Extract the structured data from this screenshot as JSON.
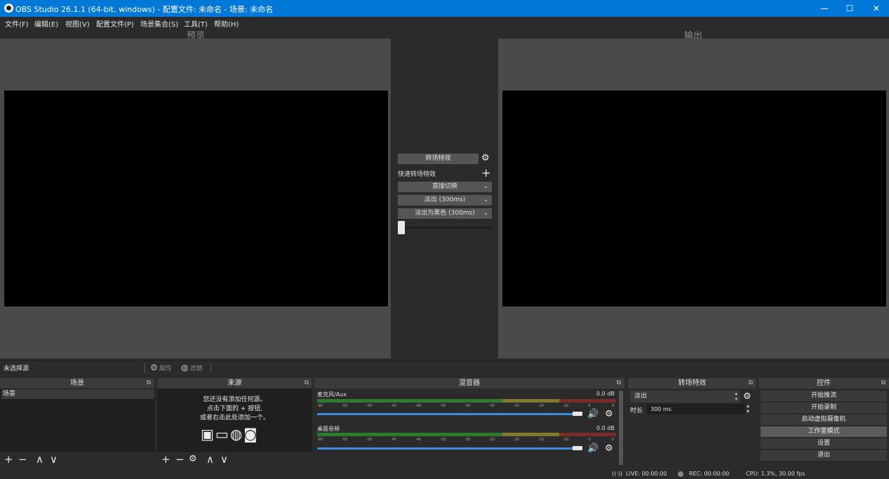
{
  "window": {
    "title": "OBS Studio 26.1.1 (64-bit, windows) - 配置文件: 未命名 - 场景: 未命名",
    "minimize": "—",
    "maximize": "☐",
    "close": "✕"
  },
  "menu": [
    "文件(F)",
    "编辑(E)",
    "视图(V)",
    "配置文件(P)",
    "场景集合(S)",
    "工具(T)",
    "帮助(H)"
  ],
  "studio": {
    "preview_label": "预览",
    "program_label": "输出",
    "transition_button": "转场特效",
    "quick_transitions_label": "快速转场特效",
    "quick_transitions": [
      "直接切换",
      "淡出 (300ms)",
      "淡出为黑色 (300ms)"
    ],
    "transition_slider": 0.0
  },
  "source_toolbar": {
    "no_source": "未选择源",
    "properties": "属性",
    "filters": "滤镜"
  },
  "docks": {
    "scenes": {
      "title": "场景",
      "items": [
        "场景"
      ]
    },
    "sources": {
      "title": "来源",
      "empty_message": [
        "您还没有添加任何源。",
        "点击下面的 + 按钮,",
        "或者右击此处添加一个。"
      ]
    },
    "mixer": {
      "title": "混音器",
      "tracks": [
        {
          "name": "麦克风/Aux",
          "db": "0.0 dB",
          "volume": 1.0
        },
        {
          "name": "桌面音频",
          "db": "0.0 dB",
          "volume": 1.0
        }
      ],
      "ticks": [
        "-60",
        "-55",
        "-50",
        "-45",
        "-40",
        "-35",
        "-30",
        "-25",
        "-20",
        "-15",
        "-10",
        "-5",
        "0"
      ]
    },
    "transitions": {
      "title": "转场特效",
      "selected": "淡出",
      "duration_label": "时长",
      "duration_value": "300 ms"
    },
    "controls": {
      "title": "控件",
      "buttons": [
        "开始推流",
        "开始录制",
        "启动虚拟摄像机",
        "工作室模式",
        "设置",
        "退出"
      ]
    }
  },
  "status": {
    "live": "LIVE: 00:00:00",
    "rec": "REC: 00:00:00",
    "cpu": "CPU: 1.3%, 30.00 fps"
  },
  "colors": {
    "titlebar": "#0078d7",
    "background": "#2b2b2b",
    "meter_green": "#2f7a2f",
    "meter_yellow": "#7f7a2c",
    "meter_red": "#7c2a2a",
    "volume_blue": "#3f8be0"
  }
}
